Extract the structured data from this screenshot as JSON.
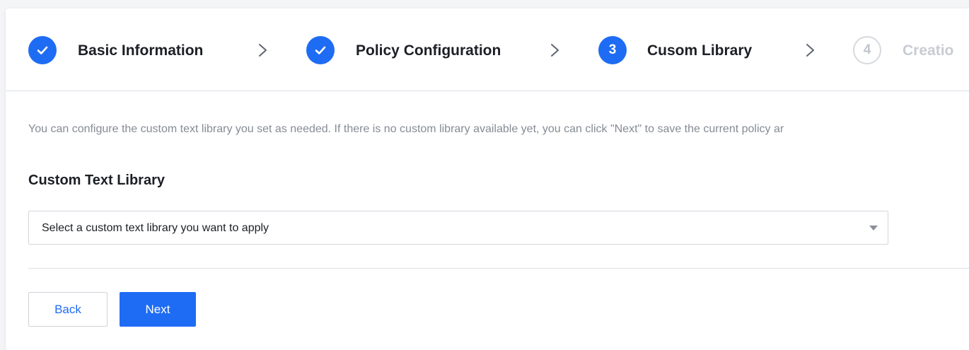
{
  "steps": [
    {
      "number": "1",
      "label": "Basic Information",
      "status": "done",
      "icon": "check-icon"
    },
    {
      "number": "2",
      "label": "Policy Configuration",
      "status": "done",
      "icon": "check-icon"
    },
    {
      "number": "3",
      "label": "Cusom Library",
      "status": "active"
    },
    {
      "number": "4",
      "label": "Creatio",
      "status": "pending"
    }
  ],
  "intro_text": "You can configure the custom text library you set as needed. If there is no custom library available yet, you can click \"Next\" to save the current policy ar",
  "section": {
    "title": "Custom Text Library"
  },
  "library_select": {
    "value": "Select a custom text library you want to apply",
    "icon": "caret-down-icon"
  },
  "buttons": {
    "back": "Back",
    "next": "Next"
  },
  "colors": {
    "primary": "#1f6cf4",
    "pending": "#c8ccd2",
    "text": "#1c1f24",
    "muted_text": "#868b94"
  }
}
